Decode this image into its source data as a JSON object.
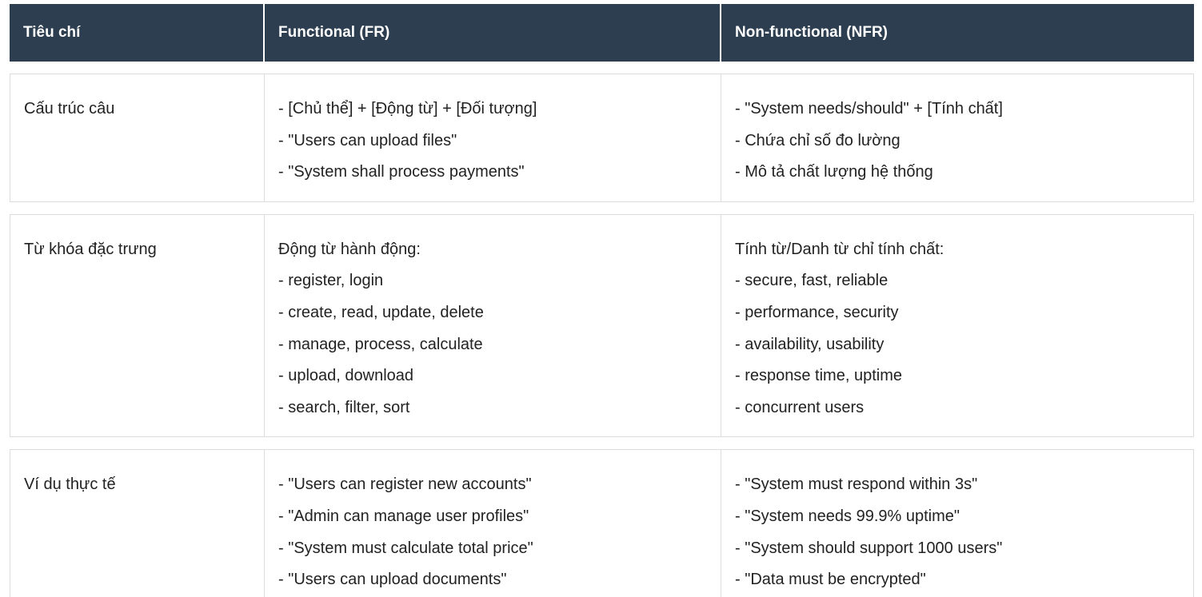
{
  "headers": [
    "Tiêu chí",
    "Functional (FR)",
    "Non-functional (NFR)"
  ],
  "rows": [
    {
      "criterion": "Cấu trúc câu",
      "fr": [
        "- [Chủ thể] + [Động từ] + [Đối tượng]",
        "- \"Users can upload files\"",
        "- \"System shall process payments\""
      ],
      "nfr": [
        "- \"System needs/should\" + [Tính chất]",
        "- Chứa chỉ số đo lường",
        "- Mô tả chất lượng hệ thống"
      ]
    },
    {
      "criterion": "Từ khóa đặc trưng",
      "fr": [
        "Động từ hành động:",
        "- register, login",
        "- create, read, update, delete",
        "- manage, process, calculate",
        "- upload, download",
        "- search, filter, sort"
      ],
      "nfr": [
        "Tính từ/Danh từ chỉ tính chất:",
        "- secure, fast, reliable",
        "- performance, security",
        "- availability, usability",
        "- response time, uptime",
        "- concurrent users"
      ]
    },
    {
      "criterion": "Ví dụ thực tế",
      "fr": [
        "- \"Users can register new accounts\"",
        "- \"Admin can manage user profiles\"",
        "- \"System must calculate total price\"",
        "- \"Users can upload documents\""
      ],
      "nfr": [
        "- \"System must respond within 3s\"",
        "- \"System needs 99.9% uptime\"",
        "- \"System should support 1000 users\"",
        "- \"Data must be encrypted\""
      ]
    }
  ],
  "colors": {
    "header_bg": "#2c3e50",
    "header_text": "#ffffff",
    "border": "#dcdcdc",
    "body_text": "#222222"
  }
}
